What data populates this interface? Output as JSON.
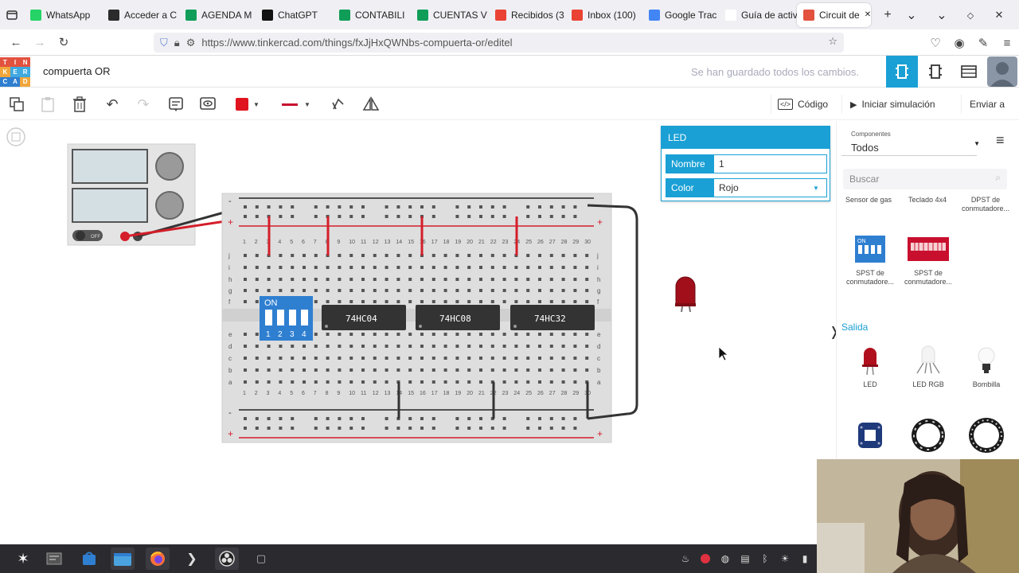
{
  "browser": {
    "tabs": [
      {
        "label": "WhatsApp",
        "color": "#25d366"
      },
      {
        "label": "Acceder a C",
        "color": "#2b2b2b"
      },
      {
        "label": "AGENDA M",
        "color": "#0f9d58"
      },
      {
        "label": "ChatGPT",
        "color": "#111111"
      },
      {
        "label": "CONTABILI",
        "color": "#0f9d58"
      },
      {
        "label": "CUENTAS V",
        "color": "#0f9d58"
      },
      {
        "label": "Recibidos (3",
        "color": "#ea4335"
      },
      {
        "label": "Inbox (100)",
        "color": "#ea4335"
      },
      {
        "label": "Google Trac",
        "color": "#4285f4"
      },
      {
        "label": "Guía de activid",
        "color": "#ffffff"
      },
      {
        "label": "Circuit de",
        "color": "#e2523f"
      }
    ],
    "url": "https://www.tinkercad.com/things/fxJjHxQWNbs-compuerta-or/editel"
  },
  "app": {
    "logo_letters": [
      "T",
      "I",
      "N",
      "K",
      "E",
      "R",
      "C",
      "A",
      "D"
    ],
    "project_title": "compuerta OR",
    "save_status": "Se han guardado todos los cambios."
  },
  "toolbar": {
    "color_value": "#e0141e",
    "code_label": "Código",
    "simulate_label": "Iniciar simulación",
    "send_label": "Enviar a"
  },
  "circuit": {
    "power_supply": {
      "switch_label": "OFF"
    },
    "breadboard": {
      "rows_top": [
        "j",
        "i",
        "h",
        "g",
        "f"
      ],
      "rows_bottom": [
        "e",
        "d",
        "c",
        "b",
        "a"
      ],
      "columns": [
        "1",
        "2",
        "3",
        "4",
        "5",
        "6",
        "7",
        "8",
        "9",
        "10",
        "11",
        "12",
        "13",
        "14",
        "15",
        "16",
        "17",
        "18",
        "19",
        "20",
        "21",
        "22",
        "23",
        "24",
        "25",
        "26",
        "27",
        "28",
        "29",
        "30"
      ],
      "plus": "+",
      "minus": "-"
    },
    "dip_switch": {
      "label": "ON",
      "numbers": [
        "1",
        "2",
        "3",
        "4"
      ]
    },
    "chips": [
      "74HC04",
      "74HC08",
      "74HC32"
    ]
  },
  "inspector": {
    "title": "LED",
    "name_label": "Nombre",
    "name_value": "1",
    "color_label": "Color",
    "color_value": "Rojo"
  },
  "panel": {
    "filter_small": "Componentes",
    "filter_value": "Todos",
    "search_placeholder": "Buscar",
    "top_items": [
      "Sensor de gas",
      "Teclado 4x4",
      "DPST de conmutadore..."
    ],
    "switch_items": [
      "SPST de conmutadore...",
      "SPST de conmutadore..."
    ],
    "dip_on_label": "ON",
    "section_output": "Salida",
    "output_items": [
      "LED",
      "LED RGB",
      "Bombilla"
    ]
  }
}
